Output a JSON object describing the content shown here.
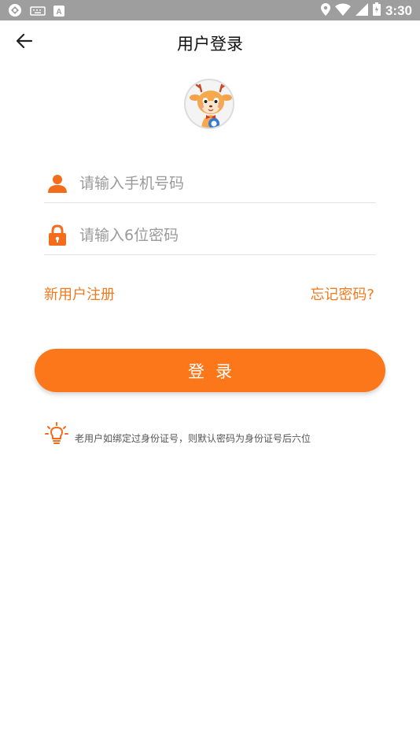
{
  "status_bar": {
    "time": "3:30",
    "icons": [
      "settings-icon",
      "keyboard-icon",
      "a-icon",
      "location-icon",
      "wifi-icon",
      "signal-icon",
      "battery-icon"
    ]
  },
  "header": {
    "title": "用户登录",
    "back_icon": "arrow-left-icon"
  },
  "form": {
    "phone": {
      "placeholder": "请输入手机号码",
      "value": "",
      "icon": "user-icon"
    },
    "password": {
      "placeholder": "请输入6位密码",
      "value": "",
      "icon": "lock-icon"
    },
    "register_label": "新用户注册",
    "forgot_label": "忘记密码?",
    "login_label": "登录"
  },
  "tip": {
    "icon": "lightbulb-icon",
    "text": "老用户如绑定过身份证号，则默认密码为身份证号后六位"
  },
  "colors": {
    "accent": "#fb7719",
    "link": "#f07a1e",
    "status_bar": "#9e9e9e"
  }
}
